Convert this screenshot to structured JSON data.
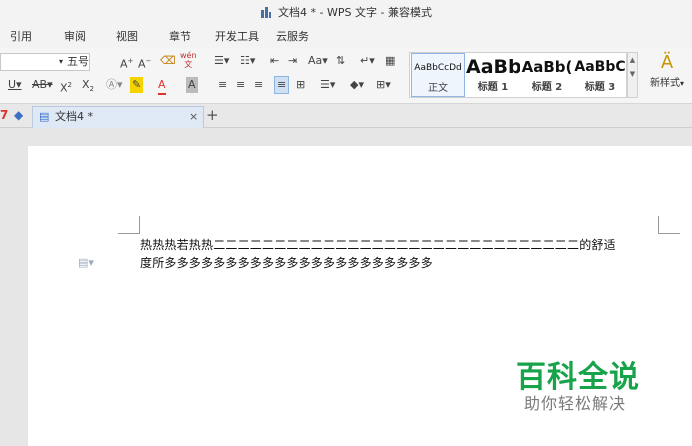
{
  "title": {
    "text": "文档4 * - WPS 文字 - 兼容模式"
  },
  "menu": [
    "引用",
    "审阅",
    "视图",
    "章节",
    "开发工具",
    "云服务"
  ],
  "ribbon": {
    "font_size": "五号",
    "wen_label": "wén",
    "styles": [
      {
        "preview": "AaBbCcDd",
        "label": "正文"
      },
      {
        "preview": "AaBb",
        "label": "标题 1"
      },
      {
        "preview": "AaBb(",
        "label": "标题 2"
      },
      {
        "preview": "AaBbC",
        "label": "标题 3"
      }
    ],
    "new_style": "新样式"
  },
  "tabs": {
    "doc": "文档4 *",
    "close": "×",
    "add": "+"
  },
  "document": {
    "line1": "热热热若热热二二二二二二二二二二二二二二二二二二二二二二二二二二二二二二的舒适",
    "line2": "度所多多多多多多多多多多多多多多多多多多多多多多"
  },
  "watermark": {
    "title": "百科全说",
    "subtitle": "助你轻松解决"
  },
  "colors": {
    "accent": "#17a34a",
    "tab_active": "#dfe8f5",
    "red_icon": "#e03030",
    "highlight": "#f5d300"
  }
}
